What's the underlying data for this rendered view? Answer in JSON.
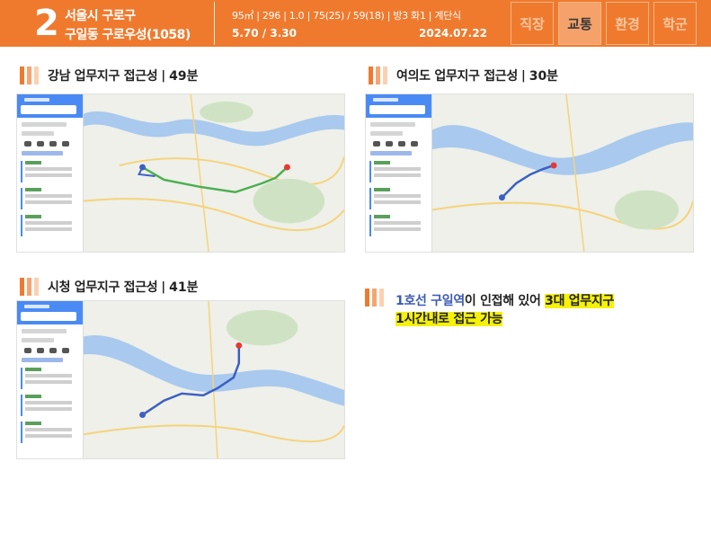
{
  "header": {
    "number": "2",
    "title_line1": "서울시 구로구",
    "title_line2": "구일동 구로우성(1058)",
    "spec_line": "95㎡ | 296 | 1.0 | 75(25) / 59(18) | 방3 화1 | 계단식",
    "price_line": "5.70 / 3.30",
    "date": "2024.07.22",
    "tabs": [
      {
        "label": "직장",
        "active": false
      },
      {
        "label": "교통",
        "active": true
      },
      {
        "label": "환경",
        "active": false
      },
      {
        "label": "학군",
        "active": false
      }
    ]
  },
  "sections": [
    {
      "title": "강남 업무지구 접근성",
      "minutes": "49분"
    },
    {
      "title": "여의도 업무지구 접근성",
      "minutes": "30분"
    },
    {
      "title": "시청 업무지구 접근성",
      "minutes": "41분"
    }
  ],
  "callout": {
    "line1_blue": "1호선 구일역",
    "line1_mid": "이 인접해 있어 ",
    "line1_highlight": "3대 업무지구",
    "line2_highlight": "1시간내로 접근 가능"
  },
  "colors": {
    "brand": "#ef7a2e",
    "route_green": "#4caf50",
    "route_blue": "#3b5fc4",
    "river": "#a9c9ee",
    "highlight": "#f5f10a"
  },
  "icons": [
    "map-pin-icon",
    "bus-icon",
    "car-icon",
    "walk-icon",
    "bike-icon"
  ]
}
